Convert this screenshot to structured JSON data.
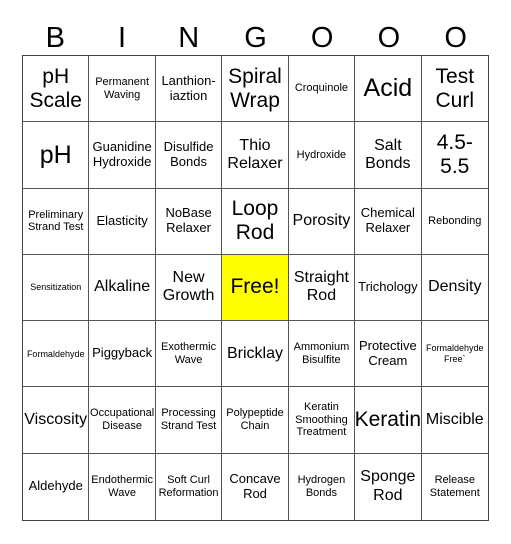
{
  "header": [
    "B",
    "I",
    "N",
    "G",
    "O",
    "O",
    "O"
  ],
  "free_color": "#ffff00",
  "cells": [
    {
      "text": "pH Scale",
      "size": "s-xl"
    },
    {
      "text": "Permanent Waving",
      "size": "s-s"
    },
    {
      "text": "Lanthion-iaztion",
      "size": "s-m"
    },
    {
      "text": "Spiral Wrap",
      "size": "s-xl"
    },
    {
      "text": "Croquinole",
      "size": "s-s"
    },
    {
      "text": "Acid",
      "size": "s-xxl"
    },
    {
      "text": "Test Curl",
      "size": "s-xl"
    },
    {
      "text": "pH",
      "size": "s-xxl"
    },
    {
      "text": "Guanidine Hydroxide",
      "size": "s-m"
    },
    {
      "text": "Disulfide Bonds",
      "size": "s-m"
    },
    {
      "text": "Thio Relaxer",
      "size": "s-l"
    },
    {
      "text": "Hydroxide",
      "size": "s-s"
    },
    {
      "text": "Salt Bonds",
      "size": "s-l"
    },
    {
      "text": "4.5-5.5",
      "size": "s-xl"
    },
    {
      "text": "Preliminary Strand Test",
      "size": "s-s"
    },
    {
      "text": "Elasticity",
      "size": "s-m"
    },
    {
      "text": "NoBase Relaxer",
      "size": "s-m"
    },
    {
      "text": "Loop Rod",
      "size": "s-xl"
    },
    {
      "text": "Porosity",
      "size": "s-l"
    },
    {
      "text": "Chemical Relaxer",
      "size": "s-m"
    },
    {
      "text": "Rebonding",
      "size": "s-s"
    },
    {
      "text": "Sensitization",
      "size": "s-xs"
    },
    {
      "text": "Alkaline",
      "size": "s-l"
    },
    {
      "text": "New Growth",
      "size": "s-l"
    },
    {
      "text": "Free!",
      "size": "s-xl",
      "free": true
    },
    {
      "text": "Straight Rod",
      "size": "s-l"
    },
    {
      "text": "Trichology",
      "size": "s-m"
    },
    {
      "text": "Density",
      "size": "s-l"
    },
    {
      "text": "Formaldehyde",
      "size": "s-xs"
    },
    {
      "text": "Piggyback",
      "size": "s-m"
    },
    {
      "text": "Exothermic Wave",
      "size": "s-s"
    },
    {
      "text": "Bricklay",
      "size": "s-l"
    },
    {
      "text": "Ammonium Bisulfite",
      "size": "s-s"
    },
    {
      "text": "Protective Cream",
      "size": "s-m"
    },
    {
      "text": "Formaldehyde Free`",
      "size": "s-xs"
    },
    {
      "text": "Viscosity",
      "size": "s-l"
    },
    {
      "text": "Occupational Disease",
      "size": "s-s"
    },
    {
      "text": "Processing Strand Test",
      "size": "s-s"
    },
    {
      "text": "Polypeptide Chain",
      "size": "s-s"
    },
    {
      "text": "Keratin Smoothing Treatment",
      "size": "s-s"
    },
    {
      "text": "Keratin",
      "size": "s-xl"
    },
    {
      "text": "Miscible",
      "size": "s-l"
    },
    {
      "text": "Aldehyde",
      "size": "s-m"
    },
    {
      "text": "Endothermic Wave",
      "size": "s-s"
    },
    {
      "text": "Soft Curl Reformation",
      "size": "s-s"
    },
    {
      "text": "Concave Rod",
      "size": "s-m"
    },
    {
      "text": "Hydrogen Bonds",
      "size": "s-s"
    },
    {
      "text": "Sponge Rod",
      "size": "s-l"
    },
    {
      "text": "Release Statement",
      "size": "s-s"
    }
  ]
}
